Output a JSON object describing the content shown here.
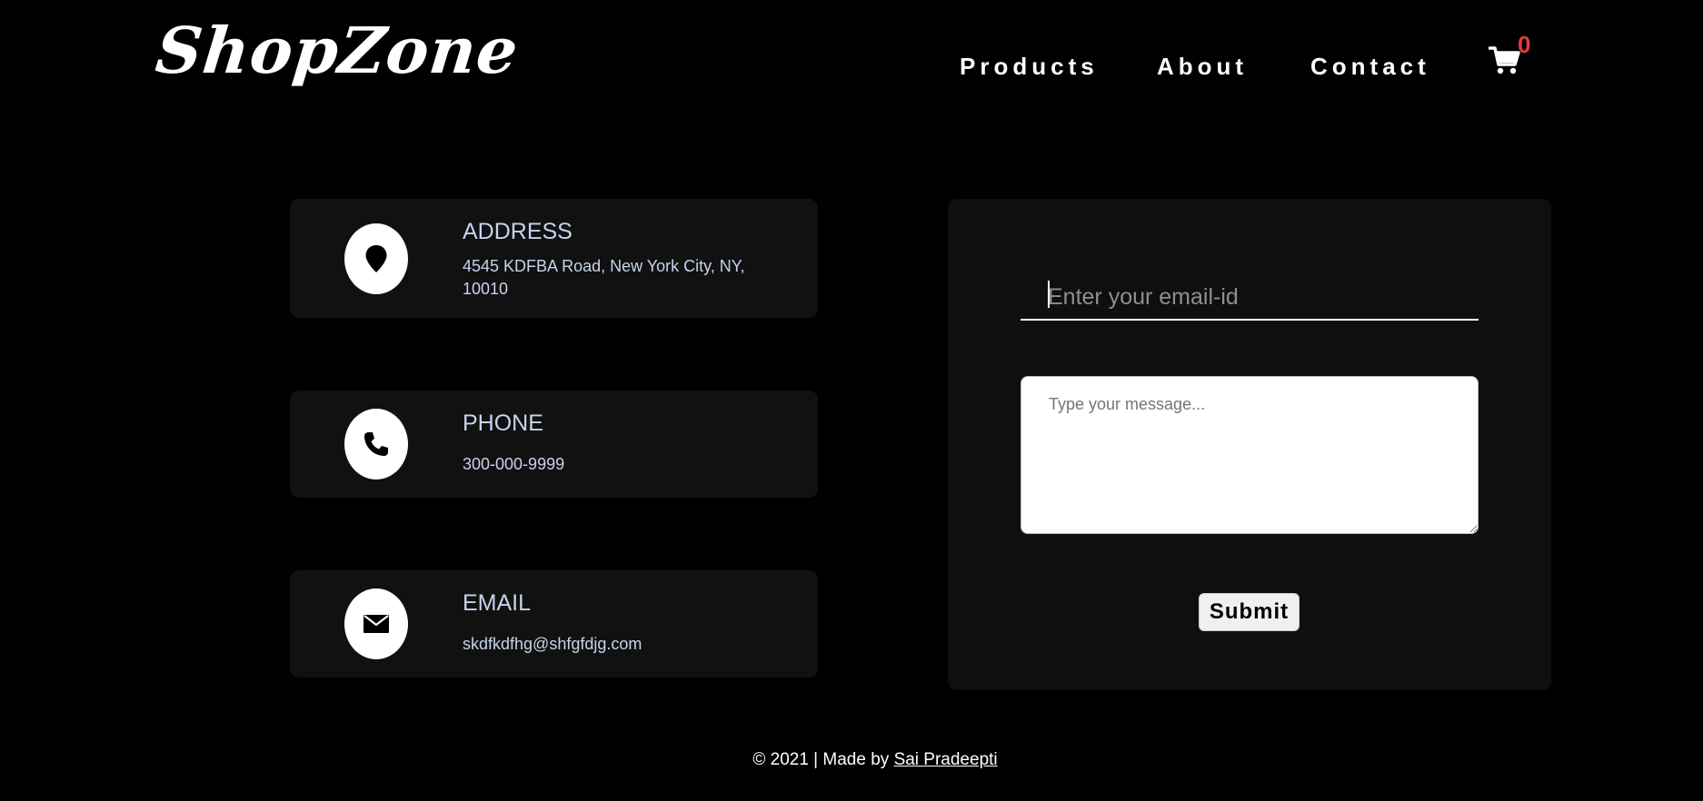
{
  "brand": {
    "logo_text": "ShopZone"
  },
  "nav": {
    "products": "Products",
    "about": "About",
    "contact": "Contact",
    "cart_icon": "cart-icon",
    "cart_count": "0"
  },
  "contact_info": {
    "address": {
      "icon": "map-pin-icon",
      "title": "ADDRESS",
      "text": "4545 KDFBA Road, New York City, NY, 10010"
    },
    "phone": {
      "icon": "phone-icon",
      "title": "PHONE",
      "text": "300-000-9999"
    },
    "email": {
      "icon": "envelope-icon",
      "title": "EMAIL",
      "text": "skdfkdfhg@shfgfdjg.com"
    }
  },
  "form": {
    "email_placeholder": "Enter your email-id",
    "email_value": "",
    "message_placeholder": "Type your message...",
    "message_value": "",
    "submit_label": "Submit"
  },
  "footer": {
    "prefix": "© 2021 | Made by ",
    "author_link": "Sai Pradeepti"
  },
  "colors": {
    "background": "#000000",
    "card_background": "#111111",
    "card_text": "#c7d3ea",
    "cart_count": "#e23b3b"
  }
}
